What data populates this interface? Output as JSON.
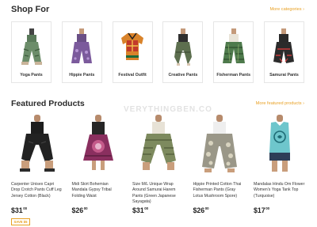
{
  "shop_for": {
    "title": "Shop For",
    "more_label": "More categories ›",
    "categories": [
      {
        "label": "Yoga Pants",
        "icon": "yoga-pants-image"
      },
      {
        "label": "Hippie Pants",
        "icon": "hippie-pants-image"
      },
      {
        "label": "Festival Outfit",
        "icon": "festival-shirt-image"
      },
      {
        "label": "Creative Pants",
        "icon": "creative-pants-image"
      },
      {
        "label": "Fisherman Pants",
        "icon": "fisherman-pants-image"
      },
      {
        "label": "Samurai Pants",
        "icon": "samurai-pants-image"
      }
    ]
  },
  "featured": {
    "title": "Featured Products",
    "more_label": "More featured products ›",
    "watermark": "VERYTHINGBEN.CO",
    "products": [
      {
        "name": "Carpenter Unisex Capri Drop Crotch Pants Cuff Leg Jersey Cotton (Black)",
        "price_dollars": "$31",
        "price_cents": "00",
        "badge": "SAVE $5"
      },
      {
        "name": "Midi Skirt Bohemian Mandala Gypsy Tribal Folding Waist",
        "price_dollars": "$26",
        "price_cents": "00",
        "badge": ""
      },
      {
        "name": "Size M/L Unique Wrap Around Samurai Harem Pants (Green Japanese Sayagata)",
        "price_dollars": "$31",
        "price_cents": "00",
        "badge": ""
      },
      {
        "name": "Hippie Printed Cotton Thai Fisherman Pants (Gray Lotus Mushroom Spore)",
        "price_dollars": "$26",
        "price_cents": "00",
        "badge": ""
      },
      {
        "name": "Mandalas Hindu Om Flower Women's Yoga Tank Top (Turquoise)",
        "price_dollars": "$17",
        "price_cents": "00",
        "badge": ""
      }
    ]
  },
  "colors": {
    "accent": "#e8a023",
    "heading": "#2b2b2b"
  }
}
